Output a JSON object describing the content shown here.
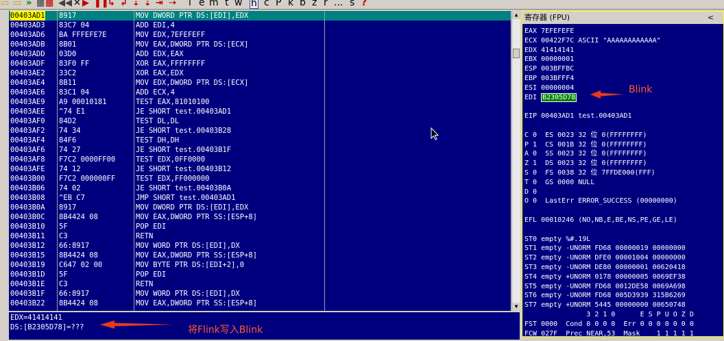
{
  "toolbar": {
    "letters": [
      "l",
      "e",
      "m",
      "t",
      "w",
      "h",
      "c",
      "P",
      "k",
      "b",
      "z",
      "r",
      "...",
      "s",
      "?"
    ]
  },
  "disasm": {
    "rows": [
      {
        "addr": "00403AD1",
        "hex": "8917",
        "asm": "MOV DWORD PTR DS:[EDI],EDX",
        "selected": true
      },
      {
        "addr": "00403AD3",
        "hex": "83C7 04",
        "asm": "ADD EDI,4"
      },
      {
        "addr": "00403AD6",
        "hex": "BA FFFEFE7E",
        "asm": "MOV EDX,7EFEFEFF"
      },
      {
        "addr": "00403ADB",
        "hex": "8B01",
        "asm": "MOV EAX,DWORD PTR DS:[ECX]"
      },
      {
        "addr": "00403ADD",
        "hex": "03D0",
        "asm": "ADD EDX,EAX"
      },
      {
        "addr": "00403ADF",
        "hex": "83F0 FF",
        "asm": "XOR EAX,FFFFFFFF"
      },
      {
        "addr": "00403AE2",
        "hex": "33C2",
        "asm": "XOR EAX,EDX"
      },
      {
        "addr": "00403AE4",
        "hex": "8B11",
        "asm": "MOV EDX,DWORD PTR DS:[ECX]"
      },
      {
        "addr": "00403AE6",
        "hex": "83C1 04",
        "asm": "ADD ECX,4"
      },
      {
        "addr": "00403AE9",
        "hex": "A9 00010181",
        "asm": "TEST EAX,81010100"
      },
      {
        "addr": "00403AEE",
        "hex": "^74 E1",
        "asm": "JE SHORT test.00403AD1"
      },
      {
        "addr": "00403AF0",
        "hex": "84D2",
        "asm": "TEST DL,DL"
      },
      {
        "addr": "00403AF2",
        "hex": "74 34",
        "asm": "JE SHORT test.00403B28"
      },
      {
        "addr": "00403AF4",
        "hex": "84F6",
        "asm": "TEST DH,DH"
      },
      {
        "addr": "00403AF6",
        "hex": "74 27",
        "asm": "JE SHORT test.00403B1F"
      },
      {
        "addr": "00403AF8",
        "hex": "F7C2 0000FF00",
        "asm": "TEST EDX,0FF0000"
      },
      {
        "addr": "00403AFE",
        "hex": "74 12",
        "asm": "JE SHORT test.00403B12"
      },
      {
        "addr": "00403B00",
        "hex": "F7C2 000000FF",
        "asm": "TEST EDX,FF000000"
      },
      {
        "addr": "00403B06",
        "hex": "74 02",
        "asm": "JE SHORT test.00403B0A"
      },
      {
        "addr": "00403B08",
        "hex": "^EB C7",
        "asm": "JMP SHORT test.00403AD1"
      },
      {
        "addr": "00403B0A",
        "hex": "8917",
        "asm": "MOV DWORD PTR DS:[EDI],EDX"
      },
      {
        "addr": "00403B0C",
        "hex": "8B4424 08",
        "asm": "MOV EAX,DWORD PTR SS:[ESP+8]"
      },
      {
        "addr": "00403B10",
        "hex": "5F",
        "asm": "POP EDI"
      },
      {
        "addr": "00403B11",
        "hex": "C3",
        "asm": "RETN"
      },
      {
        "addr": "00403B12",
        "hex": "66:8917",
        "asm": "MOV WORD PTR DS:[EDI],DX"
      },
      {
        "addr": "00403B15",
        "hex": "8B4424 08",
        "asm": "MOV EAX,DWORD PTR SS:[ESP+8]"
      },
      {
        "addr": "00403B19",
        "hex": "C647 02 00",
        "asm": "MOV BYTE PTR DS:[EDI+2],0"
      },
      {
        "addr": "00403B1D",
        "hex": "5F",
        "asm": "POP EDI"
      },
      {
        "addr": "00403B1E",
        "hex": "C3",
        "asm": "RETN"
      },
      {
        "addr": "00403B1F",
        "hex": "66:8917",
        "asm": "MOV WORD PTR DS:[EDI],DX"
      },
      {
        "addr": "00403B22",
        "hex": "8B4424 08",
        "asm": "MOV EAX,DWORD PTR SS:[ESP+8]"
      }
    ]
  },
  "info": {
    "line1": "EDX=41414141",
    "line2": "DS:[B2305D78]=???"
  },
  "registers": {
    "title": "寄存器 (FPU)",
    "collapse_glyph": "<",
    "lines": [
      "EAX 7EFEFEFE",
      "ECX 00422F7C ASCII \"AAAAAAAAAAAA\"",
      "EDX 41414141",
      "EBX 00000001",
      "ESP 003BFFBC",
      "EBP 003BFFF4",
      "ESI 00000004",
      "",
      "",
      "EIP 00403AD1 test.00403AD1",
      "",
      "C 0  ES 0023 32 位 0(FFFFFFFF)",
      "P 1  CS 001B 32 位 0(FFFFFFFF)",
      "A 0  SS 0023 32 位 0(FFFFFFFF)",
      "Z 1  DS 0023 32 位 0(FFFFFFFF)",
      "S 0  FS 0038 32 位 7FFDE000(FFF)",
      "T 0  GS 0000 NULL",
      "D 0",
      "O 0  LastErr ERROR_SUCCESS (00000000)",
      "",
      "EFL 00010246 (NO,NB,E,BE,NS,PE,GE,LE)",
      "",
      "ST0 empty %#.19L",
      "ST1 empty -UNORM FD68 00000019 00000000",
      "ST2 empty -UNORM DFE0 00001004 00000000",
      "ST3 empty -UNORM DE80 00000001 00620418",
      "ST4 empty +UNORM 0178 00000005 0069EF38",
      "ST5 empty -UNORM FD68 0012DE58 0069A698",
      "ST6 empty -UNORM FD68 005D3939 315B6269",
      "ST7 empty +UNORM 5445 00000000 00650748",
      "               3 2 1 0      E S P U O Z D",
      "FST 0000  Cond 0 0 0 0  Err 0 0 0 0 0 0 0",
      "FCW 027F  Prec NEAR,53  Mask    1 1 1 1 1"
    ],
    "edi_label": "EDI",
    "edi_value": "B2305D78"
  },
  "annotations": {
    "blink": "Blink",
    "flink_to_blink": "将Flink写入Blink"
  },
  "colors": {
    "pane_bg": "#00007f",
    "selected_row": "#008080",
    "selected_addr": "#ffff00",
    "annotation": "#ff5a2a"
  }
}
